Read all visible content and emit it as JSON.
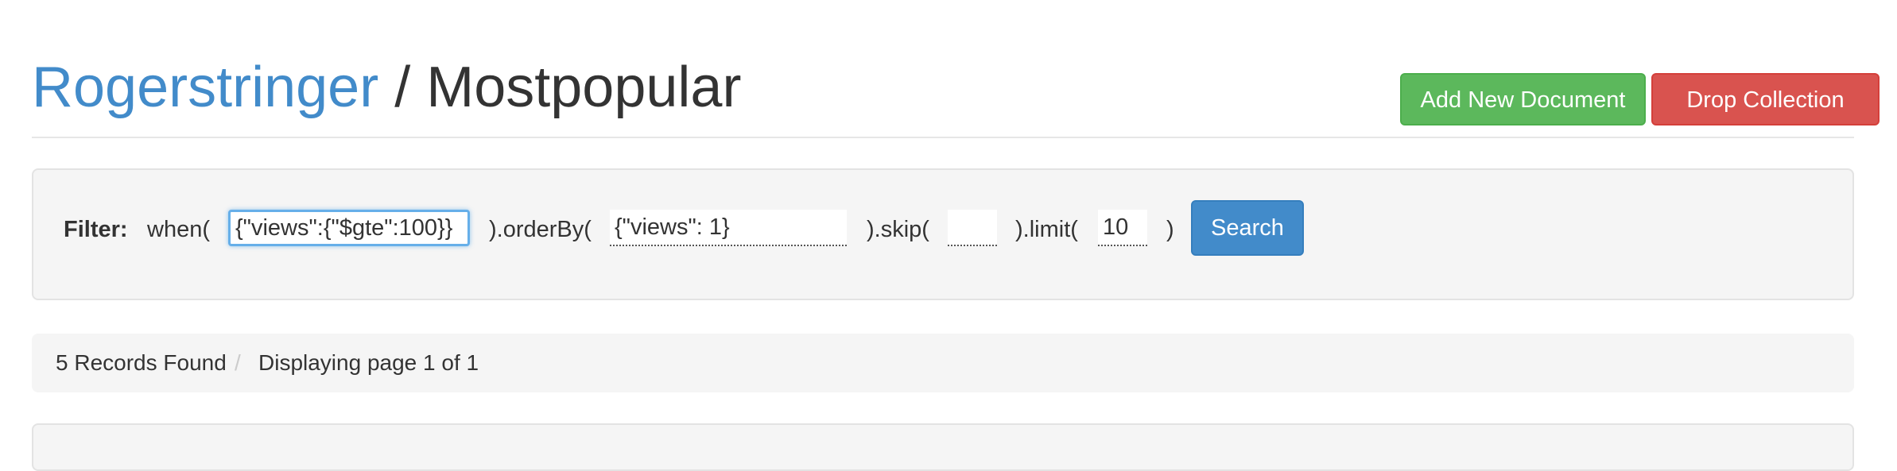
{
  "header": {
    "database": "Rogerstringer",
    "separator": "/",
    "collection": "Mostpopular",
    "add_button": "Add New Document",
    "drop_button": "Drop Collection"
  },
  "filter": {
    "label": "Filter:",
    "when_open": "when(",
    "when_value": "{\"views\":{\"$gte\":100}}",
    "orderby_open": ").orderBy(",
    "orderby_value": "{\"views\": 1}",
    "skip_open": ").skip(",
    "skip_value": "",
    "limit_open": ").limit(",
    "limit_value": "10",
    "close": ")",
    "search_button": "Search"
  },
  "records": {
    "found": "5 Records Found",
    "separator": "/",
    "page": "Displaying page 1 of 1"
  },
  "colors": {
    "link_blue": "#428bca",
    "success_green": "#5cb85c",
    "danger_red": "#d9534f",
    "panel_gray": "#f5f5f5"
  }
}
